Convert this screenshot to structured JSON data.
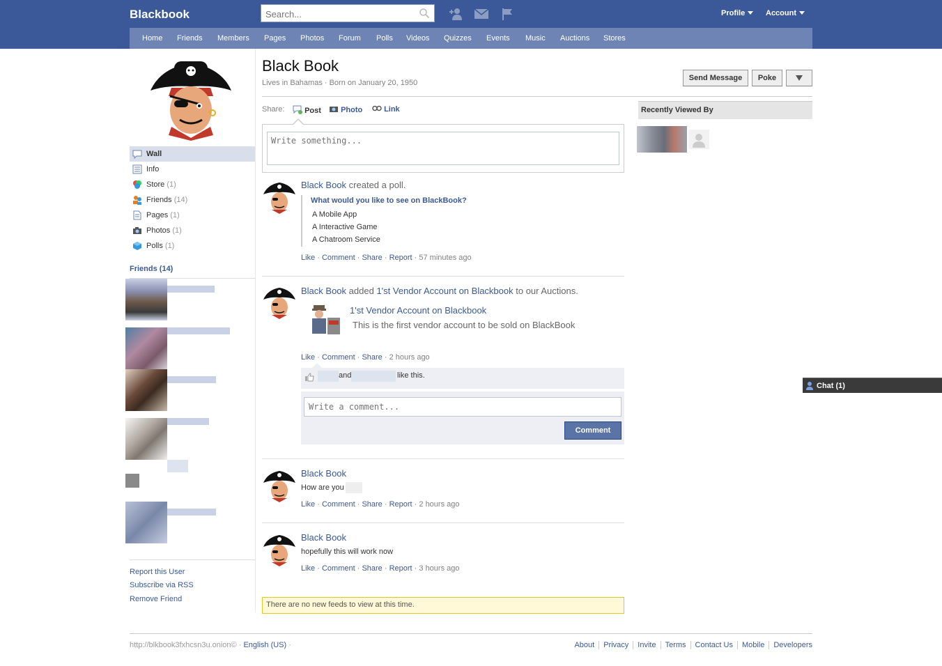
{
  "app": {
    "title": "Blackbook"
  },
  "search": {
    "placeholder": "Search..."
  },
  "topnav": {
    "profile": "Profile",
    "account": "Account"
  },
  "mainnav": [
    "Home",
    "Friends",
    "Members",
    "Pages",
    "Photos",
    "Forum",
    "Polls",
    "Videos",
    "Quizzes",
    "Events",
    "Music",
    "Auctions",
    "Stores"
  ],
  "sidebar": {
    "items": [
      {
        "label": "Wall",
        "count": ""
      },
      {
        "label": "Info",
        "count": ""
      },
      {
        "label": "Store",
        "count": "(1)"
      },
      {
        "label": "Friends",
        "count": "(14)"
      },
      {
        "label": "Pages",
        "count": "(1)"
      },
      {
        "label": "Photos",
        "count": "(1)"
      },
      {
        "label": "Polls",
        "count": "(1)"
      }
    ],
    "friends_heading": "Friends (14)",
    "links": [
      "Report this User",
      "Subscribe via RSS",
      "Remove Friend"
    ]
  },
  "profile": {
    "name": "Black Book",
    "subtitle": "Lives in Bahamas · Born on January 20, 1950",
    "buttons": {
      "send_message": "Send Message",
      "poke": "Poke"
    }
  },
  "share": {
    "label": "Share:",
    "post": "Post",
    "photo": "Photo",
    "link": "Link"
  },
  "composer": {
    "placeholder": "Write something..."
  },
  "actions": {
    "like": "Like",
    "comment": "Comment",
    "share": "Share",
    "report": "Report"
  },
  "posts": [
    {
      "author": "Black Book",
      "text": "created a poll.",
      "poll_question": "What would you like to see on BlackBook?",
      "poll_options": [
        "A Mobile App",
        "A Interactive Game",
        "A Chatroom Service"
      ],
      "time": "57 minutes ago"
    },
    {
      "author": "Black Book",
      "text_added": "added",
      "item": "1'st Vendor Account on Blackbook",
      "text_to": "to our Auctions.",
      "attach_title": "1'st Vendor Account on Blackbook",
      "attach_desc": "This is the first vendor account to be sold on BlackBook",
      "time": "2 hours ago",
      "likes_and": "and",
      "likes_this": "like this.",
      "comment_placeholder": "Write a comment...",
      "comment_button": "Comment"
    },
    {
      "author": "Black Book",
      "text": "How are you",
      "time": "2 hours ago"
    },
    {
      "author": "Black Book",
      "text": "hopefully this will work now",
      "time": "3 hours ago"
    }
  ],
  "notice": "There are no new feeds to view at this time.",
  "right": {
    "recently_viewed": "Recently Viewed By"
  },
  "chat": {
    "label": "Chat (1)"
  },
  "footer": {
    "onion": "http://blkbook3fxhcsn3u.onion© ·",
    "language": "English (US)",
    "language_sep": "·",
    "links": [
      "About",
      "Privacy",
      "Invite",
      "Terms",
      "Contact Us",
      "Mobile",
      "Developers"
    ]
  },
  "colors": {
    "brand": "#3b5998",
    "nav": "#6d84b4",
    "link": "#3b5998",
    "notice_bg": "#fff9d7",
    "chat_bar": "#3a3a3a"
  }
}
